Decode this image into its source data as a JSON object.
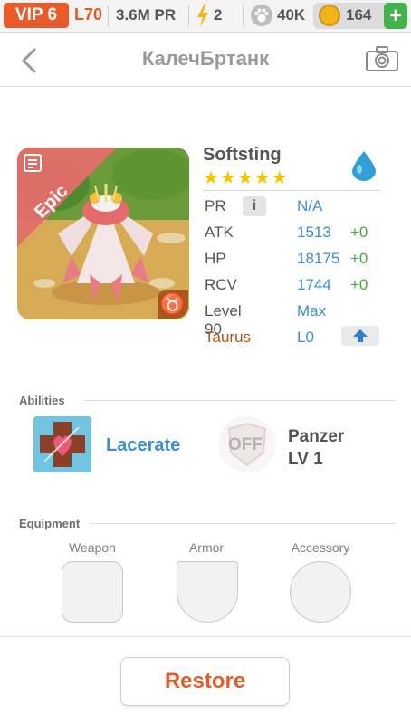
{
  "status_bar": {
    "vip": "VIP 6",
    "level": "L70",
    "power": "3.6M PR",
    "energy": "2",
    "food": "40K",
    "coins": "164",
    "add_label": "+"
  },
  "header": {
    "title": "КалечБртанк"
  },
  "pet": {
    "rarity": "Epic",
    "name": "Softsting",
    "stars": "★★★★★",
    "zodiac_symbol": "♉",
    "stats": [
      {
        "label": "PR",
        "value": "N/A",
        "bonus": ""
      },
      {
        "label": "ATK",
        "value": "1513",
        "bonus": "+0"
      },
      {
        "label": "HP",
        "value": "18175",
        "bonus": "+0"
      },
      {
        "label": "RCV",
        "value": "1744",
        "bonus": "+0"
      },
      {
        "label": "Level 90",
        "value": "Max",
        "bonus": ""
      },
      {
        "label": "Taurus",
        "value": "L0",
        "bonus": ""
      }
    ],
    "info_label": "i"
  },
  "abilities": {
    "heading": "Abilities",
    "active_name": "Lacerate",
    "passive_status": "OFF",
    "passive_name": "Panzer",
    "passive_level": "LV 1"
  },
  "equipment": {
    "heading": "Equipment",
    "slots": [
      "Weapon",
      "Armor",
      "Accessory"
    ]
  },
  "footer": {
    "restore_label": "Restore"
  },
  "colors": {
    "accent_orange": "#e75a2a",
    "value_blue": "#3c8fd0",
    "bonus_green": "#44ad3a",
    "star_yellow": "#f2c500",
    "zodiac_brown": "#a9561f"
  }
}
